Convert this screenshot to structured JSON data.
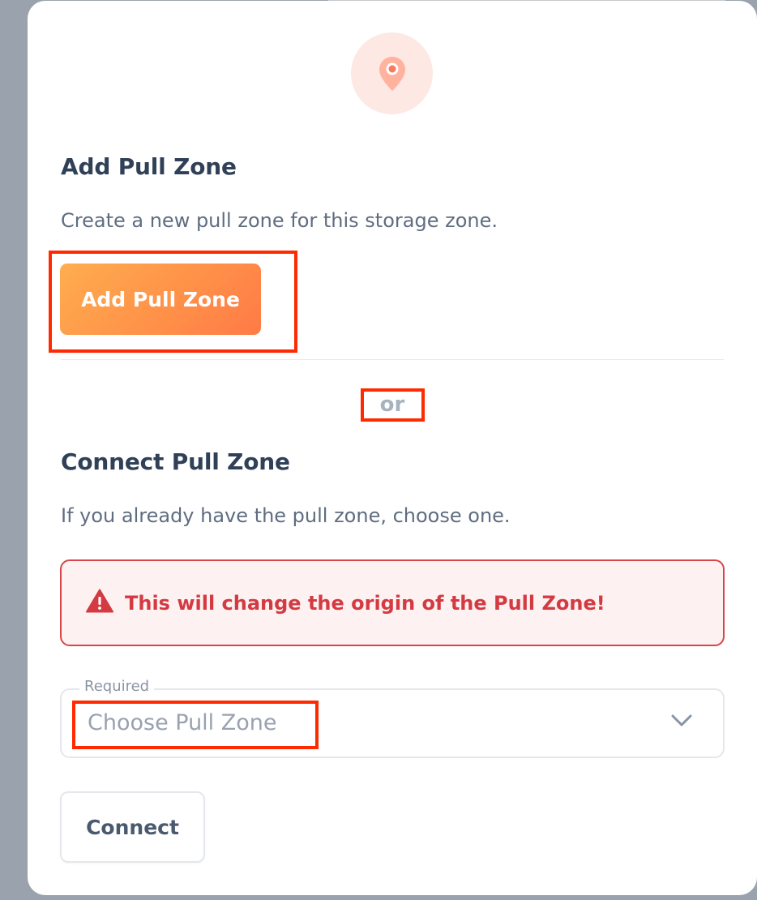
{
  "dialog": {
    "icon": "map-pin-icon",
    "add_section": {
      "title": "Add Pull Zone",
      "description": "Create a new pull zone for this storage zone.",
      "button_label": "Add Pull Zone"
    },
    "separator_text": "or",
    "connect_section": {
      "title": "Connect Pull Zone",
      "description": "If you already have the pull zone, choose one.",
      "warning": {
        "icon": "warning-triangle-icon",
        "text": "This will change the origin of the Pull Zone!"
      },
      "select": {
        "label": "Required",
        "placeholder": "Choose Pull Zone",
        "icon": "chevron-down-icon"
      },
      "button_label": "Connect"
    }
  },
  "colors": {
    "accent_start": "#ffad4f",
    "accent_end": "#ff7a47",
    "danger": "#d33a41",
    "danger_bg": "#fdf1f1",
    "icon_circle_bg": "#fde8e3",
    "annotation": "#ff2a00"
  }
}
